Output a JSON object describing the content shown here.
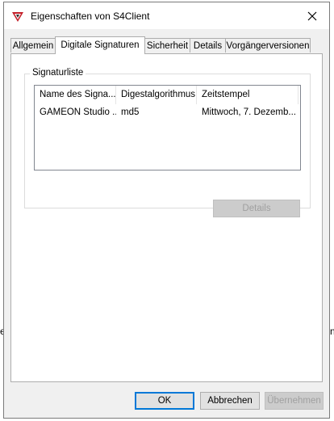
{
  "background": {
    "left_fragment": "e",
    "right_fragment": "n"
  },
  "window": {
    "title": "Eigenschaften von S4Client",
    "close_glyph": "✕"
  },
  "tabs": [
    {
      "label": "Allgemein",
      "active": false
    },
    {
      "label": "Digitale Signaturen",
      "active": true
    },
    {
      "label": "Sicherheit",
      "active": false
    },
    {
      "label": "Details",
      "active": false
    },
    {
      "label": "Vorgängerversionen",
      "active": false
    }
  ],
  "signatures": {
    "group_label": "Signaturliste",
    "columns": [
      "Name des Signa...",
      "Digestalgorithmus",
      "Zeitstempel"
    ],
    "rows": [
      {
        "name": "GAMEON Studio ...",
        "digest": "md5",
        "timestamp": "Mittwoch, 7. Dezemb..."
      }
    ],
    "details_label": "Details"
  },
  "buttons": {
    "ok": "OK",
    "cancel": "Abbrechen",
    "apply": "Übernehmen"
  },
  "colors": {
    "accent": "#0078d7",
    "icon_red": "#c4202a"
  }
}
